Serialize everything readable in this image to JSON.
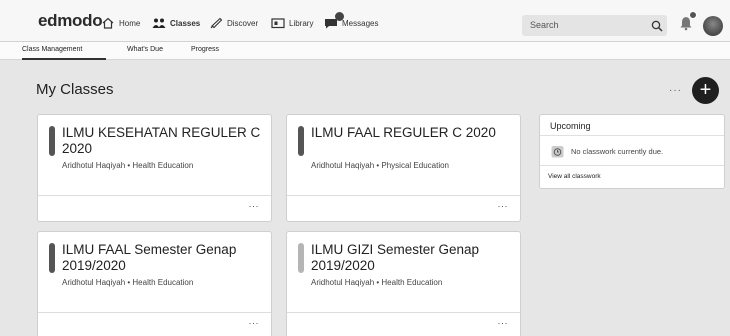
{
  "app": {
    "logo": "edmodo"
  },
  "nav": {
    "home": "Home",
    "classes": "Classes",
    "discover": "Discover",
    "library": "Library",
    "messages": "Messages"
  },
  "search": {
    "placeholder": "Search"
  },
  "subnav": {
    "items": [
      "Class Management",
      "What's Due",
      "Progress"
    ],
    "active": "Class Management"
  },
  "main": {
    "title": "My Classes",
    "more": "···",
    "add": "+"
  },
  "classes": [
    {
      "title": "ILMU KESEHATAN REGULER C 2020",
      "teacher": "Aridhotul Haqiyah",
      "subject": "Health Education",
      "subtitle": "Aridhotul Haqiyah • Health Education",
      "bar_color": "#555555"
    },
    {
      "title": "ILMU FAAL REGULER C 2020",
      "teacher": "Aridhotul Haqiyah",
      "subject": "Physical Education",
      "subtitle": "Aridhotul Haqiyah • Physical Education",
      "bar_color": "#555555"
    },
    {
      "title": "ILMU FAAL Semester Genap 2019/2020",
      "teacher": "Aridhotul Haqiyah",
      "subject": "Health Education",
      "subtitle": "Aridhotul Haqiyah • Health Education",
      "bar_color": "#555555"
    },
    {
      "title": "ILMU GIZI Semester Genap 2019/2020",
      "teacher": "Aridhotul Haqiyah",
      "subject": "Health Education",
      "subtitle": "Aridhotul Haqiyah • Health Education",
      "bar_color": "#b5b5b5"
    }
  ],
  "card_menu": "···",
  "upcoming": {
    "title": "Upcoming",
    "empty": "No classwork currently due.",
    "view_all": "View all classwork"
  }
}
